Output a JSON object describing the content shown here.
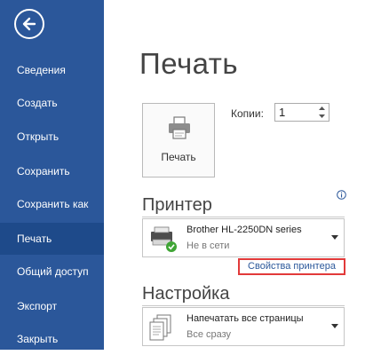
{
  "sidebar": {
    "back_icon": "arrow-left-icon",
    "items": [
      {
        "label": "Сведения"
      },
      {
        "label": "Создать"
      },
      {
        "label": "Открыть"
      },
      {
        "label": "Сохранить"
      },
      {
        "label": "Сохранить как"
      },
      {
        "label": "Печать",
        "active": true
      },
      {
        "label": "Общий доступ"
      },
      {
        "label": "Экспорт"
      },
      {
        "label": "Закрыть"
      }
    ],
    "bg_color": "#2b579a",
    "active_color": "#1e4a8a"
  },
  "main": {
    "title": "Печать",
    "print_button": {
      "label": "Печать",
      "icon": "printer-icon"
    },
    "copies": {
      "label": "Копии:",
      "value": "1"
    },
    "printer_section": {
      "title": "Принтер",
      "info_icon": "info-icon",
      "printer_name": "Brother HL-2250DN series",
      "printer_status": "Не в сети",
      "properties_link": "Свойства принтера"
    },
    "settings_section": {
      "title": "Настройка",
      "option_title": "Напечатать все страницы",
      "option_sub": "Все сразу"
    }
  },
  "colors": {
    "accent": "#2b579a",
    "highlight_border": "#e23a3a"
  }
}
